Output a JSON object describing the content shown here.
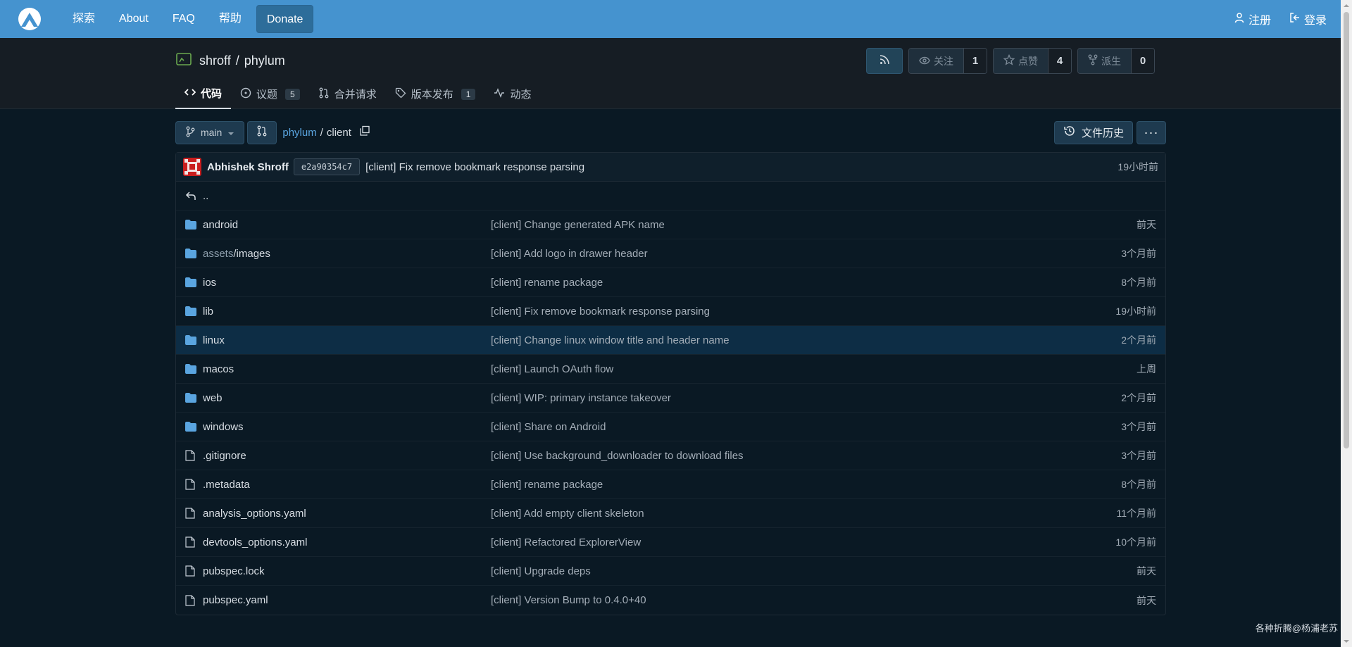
{
  "nav": {
    "links": [
      "探索",
      "About",
      "FAQ",
      "帮助"
    ],
    "donate": "Donate",
    "register": "注册",
    "login": "登录"
  },
  "repo": {
    "owner": "shroff",
    "sep": "/",
    "name": "phylum",
    "watch_label": "关注",
    "watch_count": "1",
    "star_label": "点赞",
    "star_count": "4",
    "fork_label": "派生",
    "fork_count": "0"
  },
  "tabs": [
    {
      "label": "代码"
    },
    {
      "label": "议题",
      "badge": "5"
    },
    {
      "label": "合并请求"
    },
    {
      "label": "版本发布",
      "badge": "1"
    },
    {
      "label": "动态"
    }
  ],
  "branchbar": {
    "branch": "main",
    "path_root": "phylum",
    "path_sep": "/",
    "path_current": "client",
    "history": "文件历史",
    "more": "···"
  },
  "commit": {
    "author": "Abhishek Shroff",
    "sha": "e2a90354c7",
    "message": "[client] Fix remove bookmark response parsing",
    "time": "19小时前"
  },
  "parent_dir": "..",
  "files": [
    {
      "type": "dir",
      "name": "android",
      "msg": "[client] Change generated APK name",
      "time": "前天"
    },
    {
      "type": "dir",
      "name_dim": "assets",
      "name": "/images",
      "msg": "[client] Add logo in drawer header",
      "time": "3个月前"
    },
    {
      "type": "dir",
      "name": "ios",
      "msg": "[client] rename package",
      "time": "8个月前"
    },
    {
      "type": "dir",
      "name": "lib",
      "msg": "[client] Fix remove bookmark response parsing",
      "time": "19小时前"
    },
    {
      "type": "dir",
      "name": "linux",
      "msg": "[client] Change linux window title and header name",
      "time": "2个月前"
    },
    {
      "type": "dir",
      "name": "macos",
      "msg": "[client] Launch OAuth flow",
      "time": "上周"
    },
    {
      "type": "dir",
      "name": "web",
      "msg": "[client] WIP: primary instance takeover",
      "time": "2个月前"
    },
    {
      "type": "dir",
      "name": "windows",
      "msg": "[client] Share on Android",
      "time": "3个月前"
    },
    {
      "type": "file",
      "name": ".gitignore",
      "msg": "[client] Use background_downloader to download files",
      "time": "3个月前"
    },
    {
      "type": "file",
      "name": ".metadata",
      "msg": "[client] rename package",
      "time": "8个月前"
    },
    {
      "type": "file",
      "name": "analysis_options.yaml",
      "msg": "[client] Add empty client skeleton",
      "time": "11个月前"
    },
    {
      "type": "file",
      "name": "devtools_options.yaml",
      "msg": "[client] Refactored ExplorerView",
      "time": "10个月前"
    },
    {
      "type": "file",
      "name": "pubspec.lock",
      "msg": "[client] Upgrade deps",
      "time": "前天"
    },
    {
      "type": "file",
      "name": "pubspec.yaml",
      "msg": "[client] Version Bump to 0.4.0+40",
      "time": "前天"
    }
  ],
  "watermark": "各种折腾@杨浦老苏",
  "colors": {
    "nav_bg": "#4593cf",
    "page_bg": "#0a1924",
    "link": "#5aa5e0",
    "folder": "#5aa5e0",
    "row_highlight": "#0d2d45"
  },
  "icons": {
    "logo": "gitea-logo-icon",
    "rss": "rss-icon",
    "watch": "eye-icon",
    "star": "star-icon",
    "fork": "fork-icon",
    "folder": "folder-icon",
    "file": "file-icon",
    "copy": "copy-icon",
    "history": "history-icon"
  }
}
